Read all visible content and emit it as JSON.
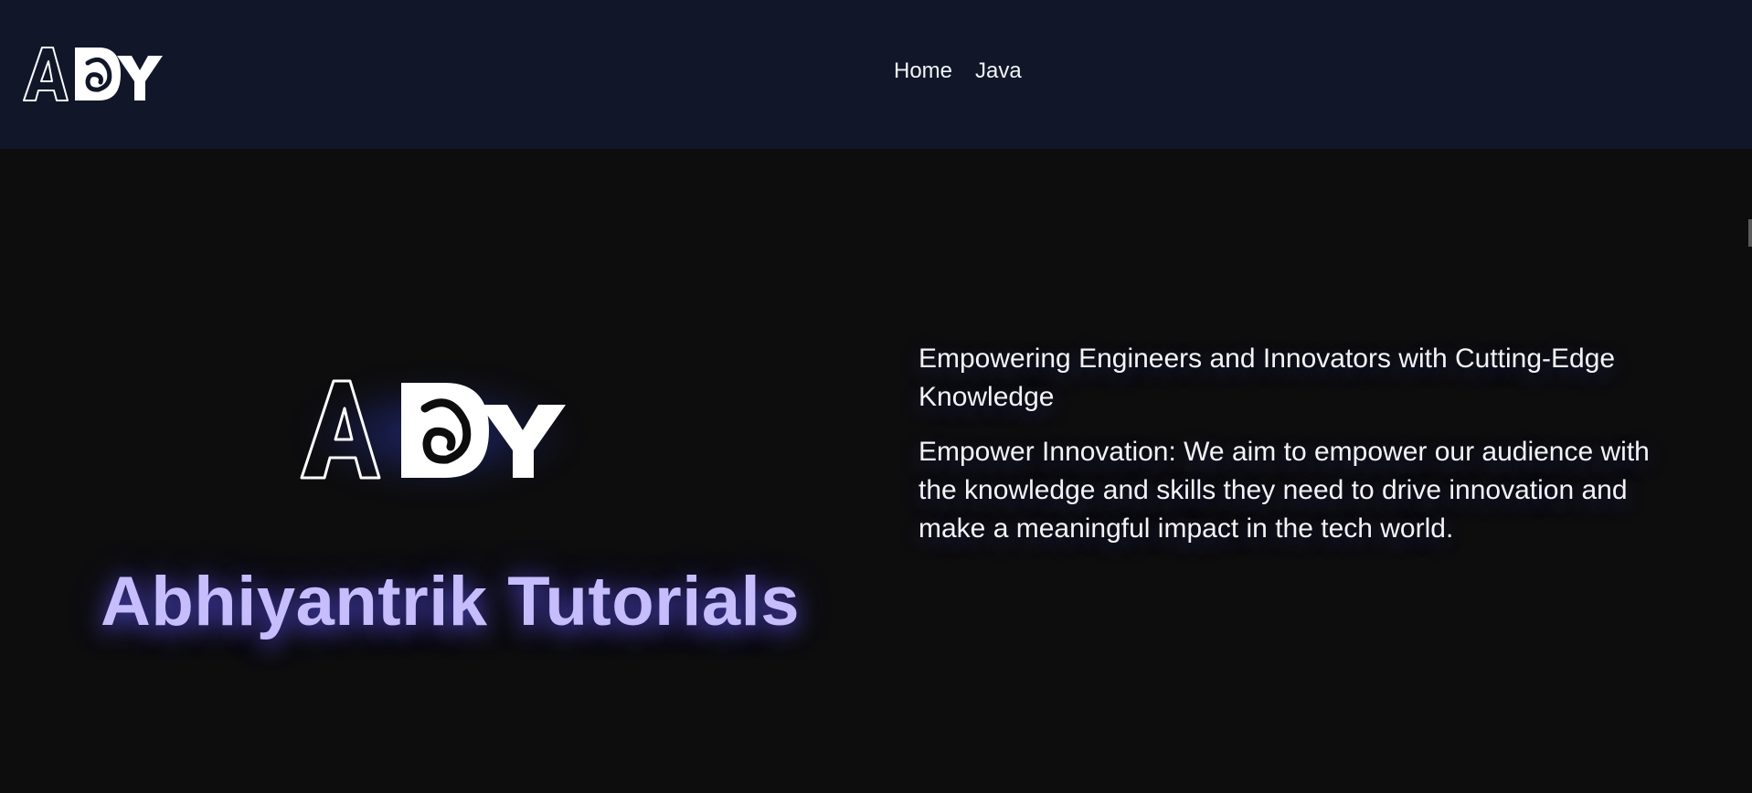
{
  "nav": {
    "logo_text": "ADY",
    "links": [
      {
        "label": "Home"
      },
      {
        "label": "Java"
      }
    ]
  },
  "hero": {
    "logo_text": "ADY",
    "title": "Abhiyantrik Tutorials",
    "tagline": "Empowering Engineers and Innovators with Cutting-Edge Knowledge",
    "mission": "Empower Innovation: We aim to empower our audience with the knowledge and skills they need to drive innovation and make a meaningful impact in the tech world."
  },
  "colors": {
    "nav_background": "#111729",
    "page_background": "#0d0d0e",
    "title_accent": "#c5bdfc",
    "glow": "#3040c8"
  }
}
